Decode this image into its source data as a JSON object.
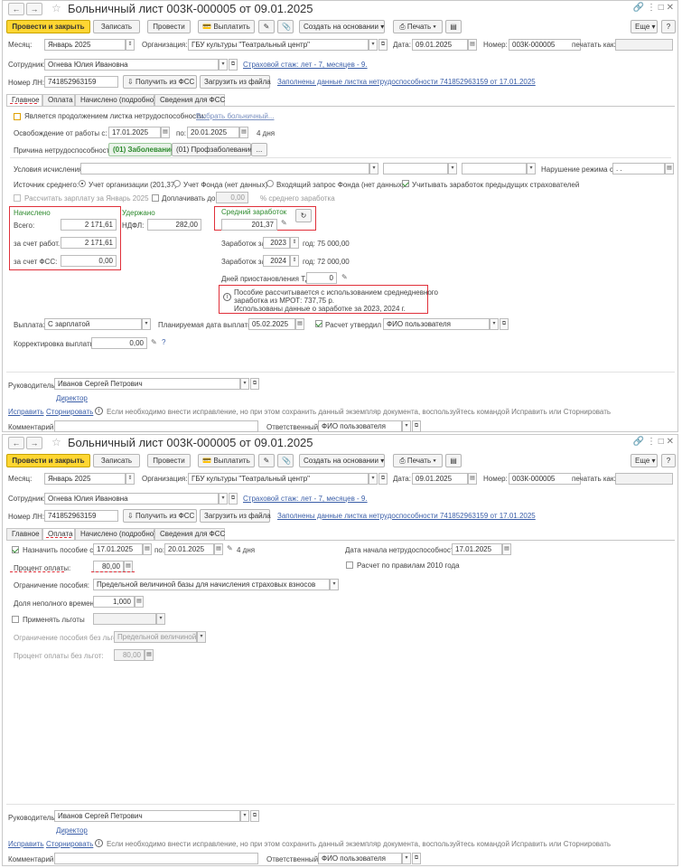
{
  "doc_title": "Больничный лист 003К-000005 от 09.01.2025",
  "toolbar": {
    "post_close": "Провести и закрыть",
    "save": "Записать",
    "post": "Провести",
    "pay": "Выплатить",
    "create_based": "Создать на основании",
    "print": "Печать",
    "more": "Еще",
    "help": "?"
  },
  "header": {
    "month_label": "Месяц:",
    "month_value": "Январь 2025",
    "org_label": "Организация:",
    "org_value": "ГБУ культуры \"Театральный центр\"",
    "date_label": "Дата:",
    "date_value": "09.01.2025",
    "number_label": "Номер:",
    "number_value": "003К-000005",
    "print_as_label": "печатать как:",
    "employee_label": "Сотрудник:",
    "employee_value": "Огнева Юлия Ивановна",
    "insurance_link": "Страховой стаж: лет - 7, месяцев - 9.",
    "ln_label": "Номер ЛН:",
    "ln_value": "741852963159",
    "get_fss": "Получить из ФСС",
    "load_file": "Загрузить из файла",
    "filled_link": "Заполнены данные листка нетрудоспособности 741852963159 от 17.01.2025"
  },
  "tabs": [
    "Главное",
    "Оплата",
    "Начислено (подробно)",
    "Сведения для ФСС"
  ],
  "main_tab": {
    "continuation_label": "Является продолжением листка нетрудоспособности:",
    "select_sick_link": "Выбрать больничный...",
    "release_label": "Освобождение от работы с:",
    "release_from": "17.01.2025",
    "to_label": "по:",
    "release_to": "20.01.2025",
    "days": "4 дня",
    "reason_label": "Причина нетрудоспособности:",
    "reason_selected": "(01) Заболевание",
    "reason_other": "(01) Профзаболевание",
    "reason_more": "...",
    "conditions_label": "Условия исчисления:",
    "violation_label": "Нарушение режима с:",
    "violation_value": " .  .",
    "source_label": "Источник среднего:",
    "source_org": "Учет организации (201,37)",
    "source_fund": "Учет Фонда (нет данных)",
    "source_request": "Входящий запрос Фонда (нет данных)",
    "consider_prev": "Учитывать заработок предыдущих страхователей",
    "calc_salary": "Рассчитать зарплату за Январь 2025",
    "pay_extra": "Доплачивать до",
    "pay_extra_value": "0,00",
    "pct_avg": "% среднего заработка",
    "accrued_title": "Начислено",
    "total_label": "Всего:",
    "total_value": "2 171,61",
    "employer_label": "за счет работ.:",
    "employer_value": "2 171,61",
    "fss_label": "за счет ФСС:",
    "fss_value": "0,00",
    "withheld_title": "Удержано",
    "ndfl_label": "НДФЛ:",
    "ndfl_value": "282,00",
    "avg_title": "Средний заработок",
    "avg_value": "201,37",
    "earn_label": "Заработок за",
    "year1": "2023",
    "year1_text": "год: 75 000,00",
    "year2": "2024",
    "year2_text": "год: 72 000,00",
    "suspension_label": "Дней приостановления ТД:",
    "suspension_value": "0",
    "note_line1": "Пособие рассчитывается с использованием среднедневного",
    "note_line2": "заработка из МРОТ: 737,75 р.",
    "note_line3": "Использованы данные о заработке за  2023,  2024 г.",
    "payout_label": "Выплата:",
    "payout_value": "С зарплатой",
    "planned_label": "Планируемая дата выплаты:",
    "planned_value": "05.02.2025",
    "approved_label": "Расчет утвердил",
    "approved_value": "ФИО пользователя",
    "correction_label": "Корректировка выплаты:",
    "correction_value": "0,00"
  },
  "pay_tab": {
    "assign_label": "Назначить пособие с:",
    "from": "17.01.2025",
    "to_label": "по:",
    "to": "20.01.2025",
    "days": "4 дня",
    "start_label": "Дата начала нетрудоспособности:",
    "start_value": "17.01.2025",
    "percent_label": "Процент оплаты:",
    "percent_value": "80,00",
    "rules2010": "Расчет по правилам 2010 года",
    "limit_label": "Ограничение пособия:",
    "limit_value": "Предельной величиной базы для начисления страховых взносов",
    "parttime_label": "Доля неполного времени:",
    "parttime_value": "1,000",
    "benefits_label": "Применять льготы",
    "limit_nobenefit_label": "Ограничение пособия без льгот:",
    "limit_nobenefit_value": "Предельной величиной б",
    "pct_nobenefit_label": "Процент оплаты без льгот:",
    "pct_nobenefit_value": "80,00"
  },
  "footer": {
    "manager_label": "Руководитель:",
    "manager_value": "Иванов Сергей Петрович",
    "manager_role": "Директор",
    "fix": "Исправить",
    "reverse": "Сторнировать",
    "fix_note": "Если необходимо внести исправление, но при этом сохранить данный экземпляр документа, воспользуйтесь командой Исправить или Сторнировать",
    "comment_label": "Комментарий:",
    "responsible_label": "Ответственный:",
    "responsible_value": "ФИО пользователя"
  },
  "colors": {
    "accent_yellow": "#ffd632",
    "highlight_red": "#e0303a",
    "link_blue": "#3a5ea8",
    "green": "#2d8a2d"
  }
}
